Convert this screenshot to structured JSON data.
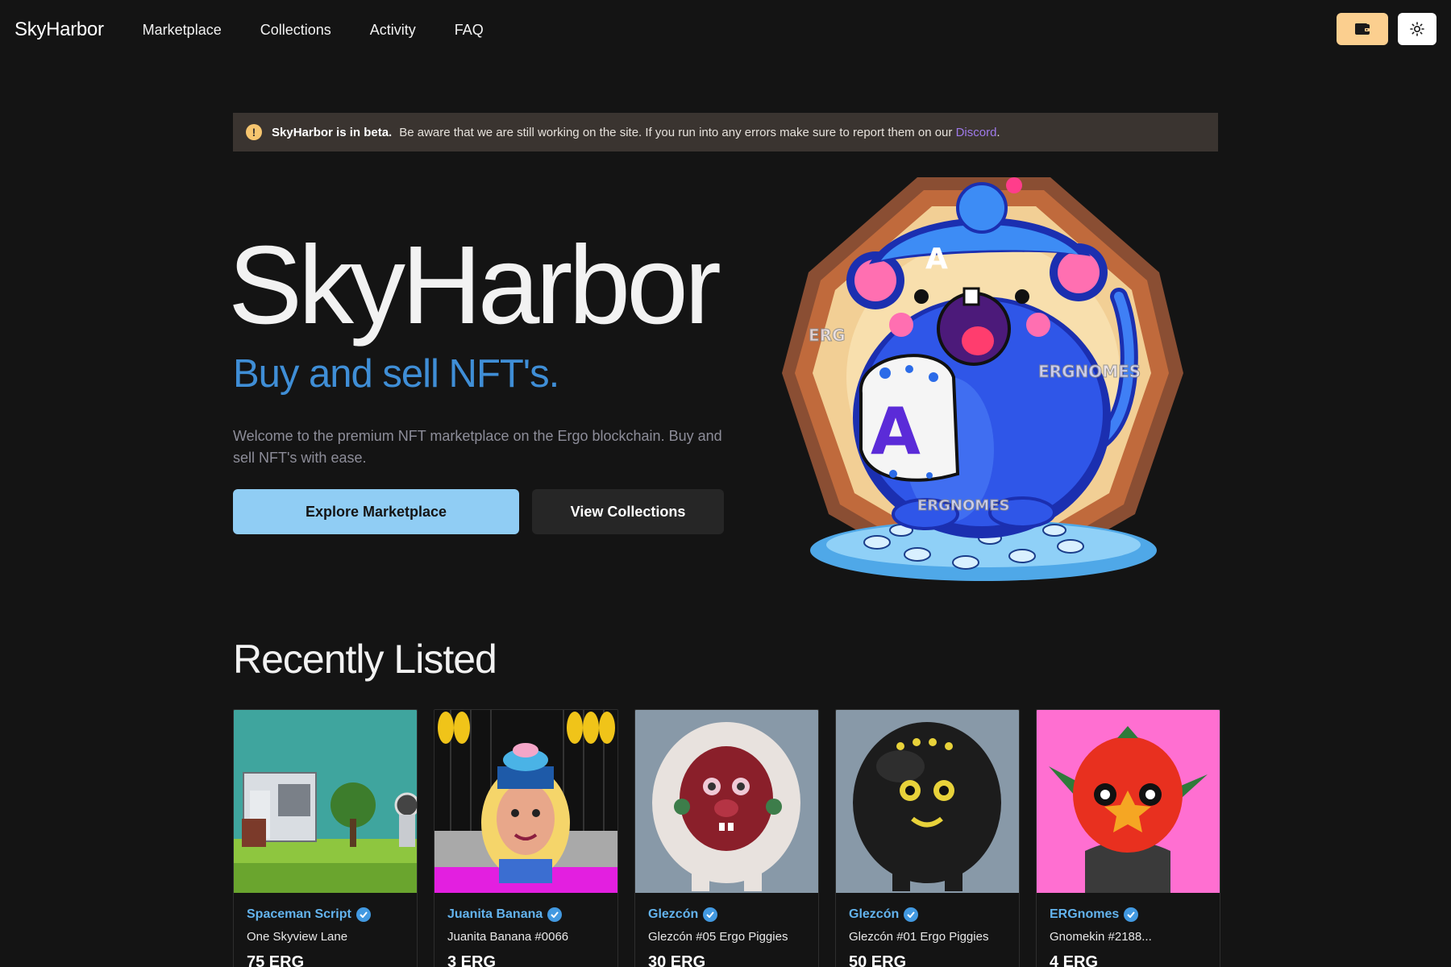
{
  "header": {
    "brand": "SkyHarbor",
    "nav": [
      "Marketplace",
      "Collections",
      "Activity",
      "FAQ"
    ],
    "wallet_icon": "wallet-icon",
    "theme_icon": "sun-icon"
  },
  "banner": {
    "title": "SkyHarbor is in beta.",
    "text": "Be aware that we are still working on the site. If you run into any errors make sure to report them on our",
    "link": "Discord",
    "suffix": "."
  },
  "hero": {
    "title": "SkyHarbor",
    "subtitle": "Buy and sell NFT's.",
    "description": "Welcome to the premium NFT marketplace on the Ergo blockchain. Buy and sell NFT's with ease.",
    "explore_label": "Explore Marketplace",
    "collections_label": "View Collections",
    "art_watermarks": [
      "ERG",
      "ERGNOMES",
      "ERGNOMES"
    ]
  },
  "recent": {
    "title": "Recently Listed",
    "cards": [
      {
        "collection": "Spaceman Script",
        "name": "One Skyview Lane",
        "price": "75 ERG"
      },
      {
        "collection": "Juanita Banana",
        "name": "Juanita Banana #0066",
        "price": "3 ERG"
      },
      {
        "collection": "Glezcón",
        "name": "Glezcón #05 Ergo Piggies",
        "price": "30 ERG"
      },
      {
        "collection": "Glezcón",
        "name": "Glezcón #01 Ergo Piggies",
        "price": "50 ERG"
      },
      {
        "collection": "ERGnomes",
        "name": "Gnomekin #2188...",
        "price": "4 ERG"
      }
    ]
  },
  "colors": {
    "background": "#141414",
    "accent_blue": "#3f8ed6",
    "explore_button": "#90cdf4",
    "wallet_button": "#fbcf8f",
    "discord_link": "#9f7aea",
    "collection_link": "#63b3ed"
  }
}
